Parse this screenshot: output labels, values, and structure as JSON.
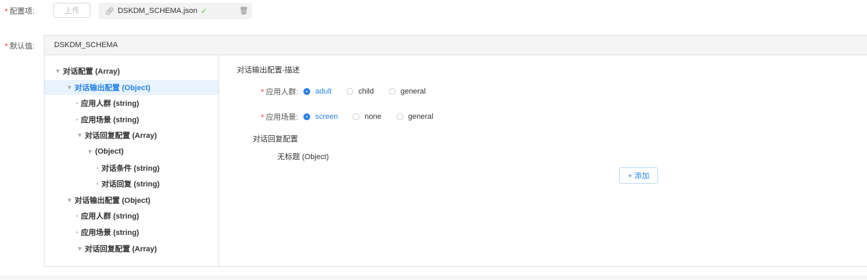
{
  "config_item": {
    "label": "配置项:",
    "upload_label": "上传",
    "file_name": "DSKDM_SCHEMA.json",
    "icons": {
      "clip": "paperclip-icon",
      "ok": "check-icon",
      "delete": "trash-icon"
    }
  },
  "default_value": {
    "label": "默认值:",
    "header": "DSKDM_SCHEMA"
  },
  "tree": [
    {
      "label": "对话配置 (Array)",
      "kind": "array",
      "depth": 0,
      "selected": false
    },
    {
      "label": "对话输出配置 (Object)",
      "kind": "object",
      "depth": 1,
      "selected": true
    },
    {
      "label": "应用人群 (string)",
      "kind": "leaf",
      "depth": 1,
      "selected": false
    },
    {
      "label": "应用场景 (string)",
      "kind": "leaf",
      "depth": 1,
      "selected": false
    },
    {
      "label": "对话回复配置 (Array)",
      "kind": "array",
      "depth": 2,
      "selected": false
    },
    {
      "label": "(Object)",
      "kind": "object",
      "depth": 3,
      "selected": false
    },
    {
      "label": "对话条件 (string)",
      "kind": "leaf",
      "depth": 3,
      "selected": false
    },
    {
      "label": "对话回复 (string)",
      "kind": "leaf",
      "depth": 3,
      "selected": false
    },
    {
      "label": "对话输出配置 (Object)",
      "kind": "object",
      "depth": 1,
      "selected": false
    },
    {
      "label": "应用人群 (string)",
      "kind": "leaf",
      "depth": 1,
      "selected": false
    },
    {
      "label": "应用场景 (string)",
      "kind": "leaf",
      "depth": 1,
      "selected": false
    },
    {
      "label": "对话回复配置 (Array)",
      "kind": "array",
      "depth": 2,
      "selected": false
    }
  ],
  "form": {
    "section_title": "对话输出配置-描述",
    "audience": {
      "label": "应用人群:",
      "options": [
        "adult",
        "child",
        "general"
      ],
      "selected": "adult"
    },
    "scene": {
      "label": "应用场景:",
      "options": [
        "screen",
        "none",
        "general"
      ],
      "selected": "screen"
    },
    "reply_config_title": "对话回复配置",
    "untitled_object": "无标题 (Object)",
    "add_label": "+ 添加"
  },
  "colors": {
    "accent": "#2a82e4",
    "required": "#f5222d",
    "selected_bg": "#e8f3fe"
  }
}
